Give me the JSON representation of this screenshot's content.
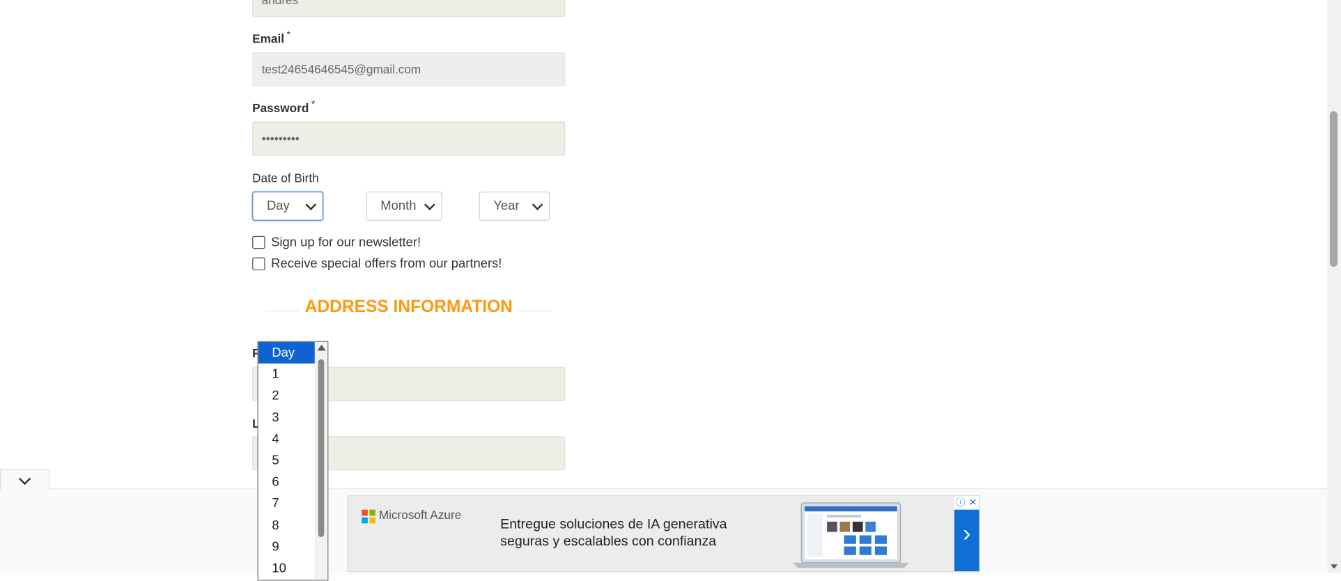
{
  "form": {
    "name_value": "andres",
    "email_label": "Email",
    "email_required": "*",
    "email_value": "test24654646545@gmail.com",
    "password_label": "Password",
    "password_required": "*",
    "password_value": "•••••••••",
    "dob_label": "Date of Birth",
    "day_select": "Day",
    "month_select": "Month",
    "year_select": "Year",
    "newsletter_label": "Sign up for our newsletter!",
    "offers_label": "Receive special offers from our partners!",
    "address_heading": "ADDRESS INFORMATION",
    "first_name_label_partial": "F",
    "last_name_label_partial": "L"
  },
  "day_dropdown": {
    "options": [
      "Day",
      "1",
      "2",
      "3",
      "4",
      "5",
      "6",
      "7",
      "8",
      "9",
      "10"
    ],
    "selected": "Day"
  },
  "ad": {
    "brand": "Microsoft Azure",
    "headline_line1": "Entregue soluciones de IA generativa",
    "headline_line2": "seguras y escalables con confianza",
    "info_icon": "ⓘ",
    "close_icon": "✕",
    "arrow": "›"
  },
  "colors": {
    "accent_orange": "#fe980f",
    "selected_blue": "#0f63d1",
    "ad_arrow_blue": "#0f6fd6"
  }
}
